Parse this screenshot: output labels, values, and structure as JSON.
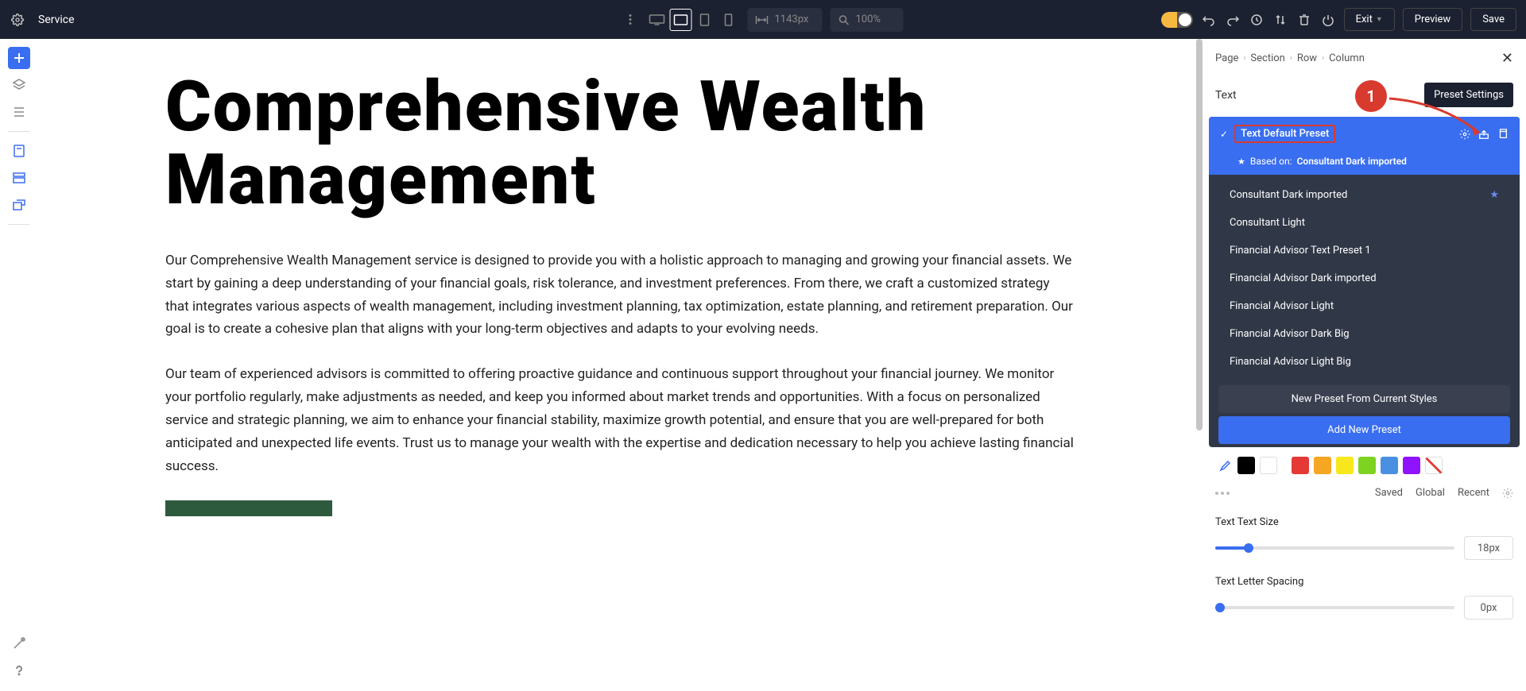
{
  "topbar": {
    "page_name": "Service",
    "width_value": "1143px",
    "zoom_value": "100%",
    "exit": "Exit",
    "preview": "Preview",
    "save": "Save"
  },
  "canvas": {
    "heading": "Comprehensive Wealth Management",
    "para1": "Our Comprehensive Wealth Management service is designed to provide you with a holistic approach to managing and growing your financial assets. We start by gaining a deep understanding of your financial goals, risk tolerance, and investment preferences. From there, we craft a customized strategy that integrates various aspects of wealth management, including investment planning, tax optimization, estate planning, and retirement preparation. Our goal is to create a cohesive plan that aligns with your long-term objectives and adapts to your evolving needs.",
    "para2": "Our team of experienced advisors is committed to offering proactive guidance and continuous support throughout your financial journey. We monitor your portfolio regularly, make adjustments as needed, and keep you informed about market trends and opportunities. With a focus on personalized service and strategic planning, we aim to enhance your financial stability, maximize growth potential, and ensure that you are well-prepared for both anticipated and unexpected life events. Trust us to manage your wealth with the expertise and dedication necessary to help you achieve lasting financial success."
  },
  "breadcrumbs": [
    "Page",
    "Section",
    "Row",
    "Column"
  ],
  "panel": {
    "title": "Text",
    "tooltip": "Preset Settings",
    "callout_num": "1",
    "active_preset": "Text Default Preset",
    "based_on_prefix": "Based on:",
    "based_on": "Consultant Dark imported",
    "presets": [
      "Consultant Dark imported",
      "Consultant Light",
      "Financial Advisor Text Preset 1",
      "Financial Advisor Dark imported",
      "Financial Advisor Light",
      "Financial Advisor Dark Big",
      "Financial Advisor Light Big"
    ],
    "new_from_current": "New Preset From Current Styles",
    "add_new": "Add New Preset",
    "tabs": {
      "saved": "Saved",
      "global": "Global",
      "recent": "Recent"
    },
    "text_size_label": "Text Text Size",
    "text_size_value": "18px",
    "letter_spacing_label": "Text Letter Spacing",
    "letter_spacing_value": "0px"
  },
  "colors": [
    "#000000",
    "#ffffff",
    "#e53935",
    "#f5a623",
    "#f8e71c",
    "#7ed321",
    "#4a90e2",
    "#9013fe"
  ]
}
